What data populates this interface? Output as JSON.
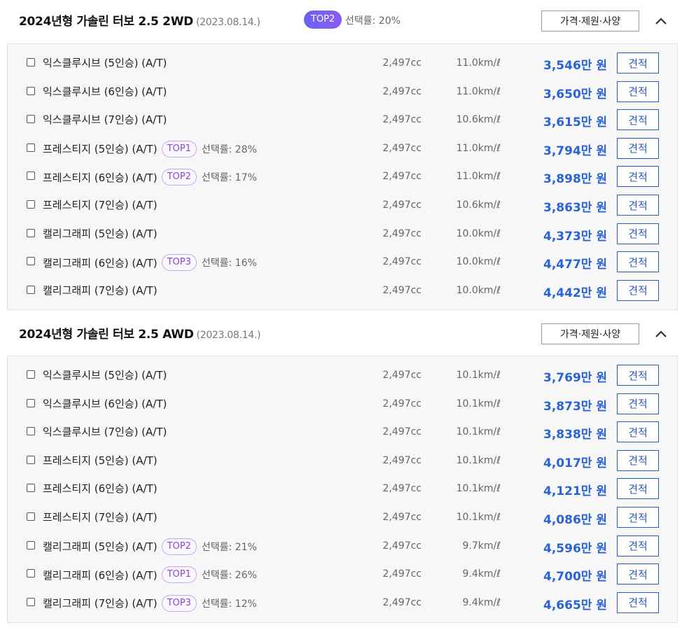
{
  "sections": [
    {
      "title": "2024년형 가솔린 터보 2.5 2WD",
      "date": "(2023.08.14.)",
      "badge": "TOP2",
      "rate": "선택률: 20%",
      "spec_label": "가격·제원·사양",
      "collapse_icon": "chevron-up-icon",
      "rows": [
        {
          "trim": "익스클루시브 (5인승) (A/T)",
          "badge": "",
          "rate": "",
          "cc": "2,497cc",
          "eff": "11.0km/ℓ",
          "price": "3,546",
          "unit": "만 원",
          "quote": "견적"
        },
        {
          "trim": "익스클루시브 (6인승) (A/T)",
          "badge": "",
          "rate": "",
          "cc": "2,497cc",
          "eff": "11.0km/ℓ",
          "price": "3,650",
          "unit": "만 원",
          "quote": "견적"
        },
        {
          "trim": "익스클루시브 (7인승) (A/T)",
          "badge": "",
          "rate": "",
          "cc": "2,497cc",
          "eff": "10.6km/ℓ",
          "price": "3,615",
          "unit": "만 원",
          "quote": "견적"
        },
        {
          "trim": "프레스티지 (5인승) (A/T)",
          "badge": "TOP1",
          "rate": "선택률: 28%",
          "cc": "2,497cc",
          "eff": "11.0km/ℓ",
          "price": "3,794",
          "unit": "만 원",
          "quote": "견적"
        },
        {
          "trim": "프레스티지 (6인승) (A/T)",
          "badge": "TOP2",
          "rate": "선택률: 17%",
          "cc": "2,497cc",
          "eff": "11.0km/ℓ",
          "price": "3,898",
          "unit": "만 원",
          "quote": "견적"
        },
        {
          "trim": "프레스티지 (7인승) (A/T)",
          "badge": "",
          "rate": "",
          "cc": "2,497cc",
          "eff": "10.6km/ℓ",
          "price": "3,863",
          "unit": "만 원",
          "quote": "견적"
        },
        {
          "trim": "캘리그래피 (5인승) (A/T)",
          "badge": "",
          "rate": "",
          "cc": "2,497cc",
          "eff": "10.0km/ℓ",
          "price": "4,373",
          "unit": "만 원",
          "quote": "견적"
        },
        {
          "trim": "캘리그래피 (6인승) (A/T)",
          "badge": "TOP3",
          "rate": "선택률: 16%",
          "cc": "2,497cc",
          "eff": "10.0km/ℓ",
          "price": "4,477",
          "unit": "만 원",
          "quote": "견적"
        },
        {
          "trim": "캘리그래피 (7인승) (A/T)",
          "badge": "",
          "rate": "",
          "cc": "2,497cc",
          "eff": "10.0km/ℓ",
          "price": "4,442",
          "unit": "만 원",
          "quote": "견적"
        }
      ]
    },
    {
      "title": "2024년형 가솔린 터보 2.5 AWD",
      "date": "(2023.08.14.)",
      "badge": "",
      "rate": "",
      "spec_label": "가격·제원·사양",
      "collapse_icon": "chevron-up-icon",
      "rows": [
        {
          "trim": "익스클루시브 (5인승) (A/T)",
          "badge": "",
          "rate": "",
          "cc": "2,497cc",
          "eff": "10.1km/ℓ",
          "price": "3,769",
          "unit": "만 원",
          "quote": "견적"
        },
        {
          "trim": "익스클루시브 (6인승) (A/T)",
          "badge": "",
          "rate": "",
          "cc": "2,497cc",
          "eff": "10.1km/ℓ",
          "price": "3,873",
          "unit": "만 원",
          "quote": "견적"
        },
        {
          "trim": "익스클루시브 (7인승) (A/T)",
          "badge": "",
          "rate": "",
          "cc": "2,497cc",
          "eff": "10.1km/ℓ",
          "price": "3,838",
          "unit": "만 원",
          "quote": "견적"
        },
        {
          "trim": "프레스티지 (5인승) (A/T)",
          "badge": "",
          "rate": "",
          "cc": "2,497cc",
          "eff": "10.1km/ℓ",
          "price": "4,017",
          "unit": "만 원",
          "quote": "견적"
        },
        {
          "trim": "프레스티지 (6인승) (A/T)",
          "badge": "",
          "rate": "",
          "cc": "2,497cc",
          "eff": "10.1km/ℓ",
          "price": "4,121",
          "unit": "만 원",
          "quote": "견적"
        },
        {
          "trim": "프레스티지 (7인승) (A/T)",
          "badge": "",
          "rate": "",
          "cc": "2,497cc",
          "eff": "10.1km/ℓ",
          "price": "4,086",
          "unit": "만 원",
          "quote": "견적"
        },
        {
          "trim": "캘리그래피 (5인승) (A/T)",
          "badge": "TOP2",
          "rate": "선택률: 21%",
          "cc": "2,497cc",
          "eff": "9.7km/ℓ",
          "price": "4,596",
          "unit": "만 원",
          "quote": "견적"
        },
        {
          "trim": "캘리그래피 (6인승) (A/T)",
          "badge": "TOP1",
          "rate": "선택률: 26%",
          "cc": "2,497cc",
          "eff": "9.4km/ℓ",
          "price": "4,700",
          "unit": "만 원",
          "quote": "견적"
        },
        {
          "trim": "캘리그래피 (7인승) (A/T)",
          "badge": "TOP3",
          "rate": "선택률: 12%",
          "cc": "2,497cc",
          "eff": "9.4km/ℓ",
          "price": "4,665",
          "unit": "만 원",
          "quote": "견적"
        }
      ]
    }
  ],
  "colors": {
    "price": "#2a63d6",
    "badge": "#8a47d6",
    "accent": "#6a62f2"
  }
}
